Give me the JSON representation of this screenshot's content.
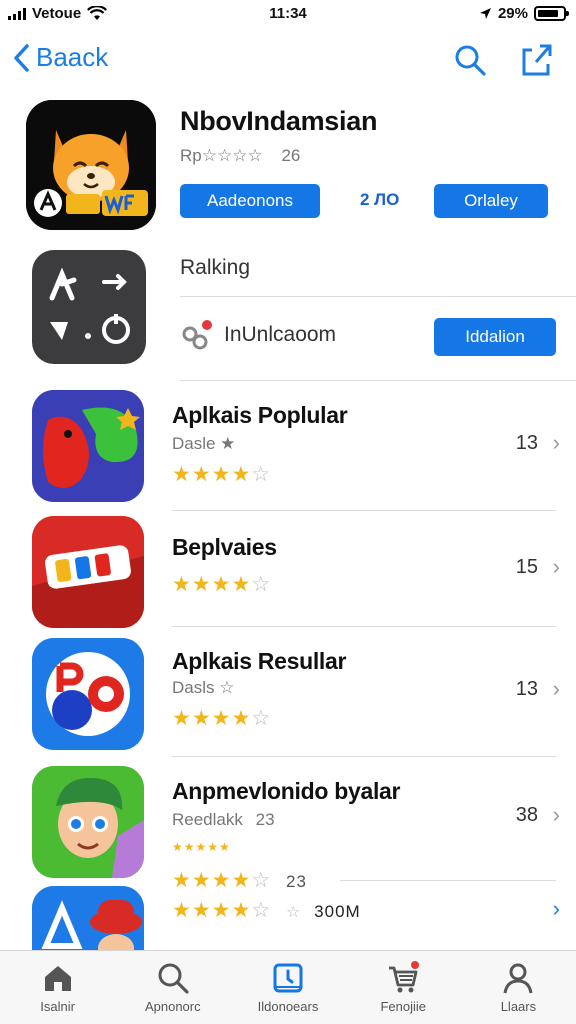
{
  "status": {
    "carrier": "Vetoue",
    "time": "11:34",
    "battery": "29%"
  },
  "nav": {
    "back_label": "Baack",
    "search_icon": "search-icon",
    "share_icon": "share-icon",
    "accent": "#1a7ee6"
  },
  "featured": {
    "title": "NbovIndamsian",
    "sub_text": "Rp☆☆☆☆",
    "sub_count": "26",
    "primary_button": "Aadeonons",
    "size": "2 ЛО",
    "secondary_button": "Orlaley"
  },
  "ranking": {
    "label": "Ralking",
    "item_label": "InUnlcaoom",
    "item_button": "Iddalion"
  },
  "apps": [
    {
      "title": "Aplkais Poplular",
      "subtitle": "Dasle ★",
      "stars": 4,
      "count": "13"
    },
    {
      "title": "Beplvaies",
      "subtitle": "",
      "stars": 4,
      "count": "15"
    },
    {
      "title": "Aplkais Resullar",
      "subtitle": "Dasls ☆",
      "stars": 4,
      "count": "13"
    },
    {
      "title": "Anpmevlonido byalar",
      "subtitle": "Reedlakk",
      "subtitle_count": "23",
      "stars": 4,
      "count": "38",
      "small_stars": "★★★★★",
      "extra_count": "23"
    }
  ],
  "partial_row": {
    "stars": 4,
    "size": "300M"
  },
  "tabs": [
    {
      "label": "Isalnir",
      "icon": "home-icon"
    },
    {
      "label": "Apnonorc",
      "icon": "search-icon"
    },
    {
      "label": "Ildonoears",
      "icon": "calendar-icon"
    },
    {
      "label": "Fenojiie",
      "icon": "cart-icon"
    },
    {
      "label": "Llaars",
      "icon": "person-icon"
    }
  ]
}
